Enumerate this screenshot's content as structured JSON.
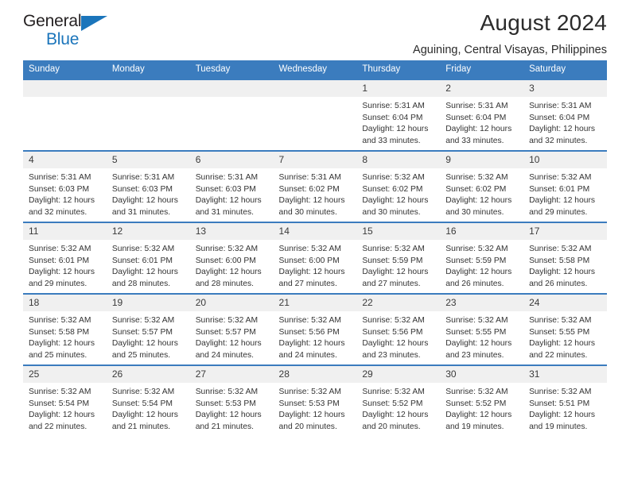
{
  "brand": {
    "name_top": "General",
    "name_bottom": "Blue",
    "accent_color": "#1b75bb"
  },
  "header": {
    "title": "August 2024",
    "subtitle": "Aguining, Central Visayas, Philippines"
  },
  "calendar": {
    "header_color": "#3b7cbe",
    "weekday_headers": [
      "Sunday",
      "Monday",
      "Tuesday",
      "Wednesday",
      "Thursday",
      "Friday",
      "Saturday"
    ],
    "weeks": [
      [
        {
          "day": "",
          "lines": []
        },
        {
          "day": "",
          "lines": []
        },
        {
          "day": "",
          "lines": []
        },
        {
          "day": "",
          "lines": []
        },
        {
          "day": "1",
          "lines": [
            "Sunrise: 5:31 AM",
            "Sunset: 6:04 PM",
            "Daylight: 12 hours",
            "and 33 minutes."
          ]
        },
        {
          "day": "2",
          "lines": [
            "Sunrise: 5:31 AM",
            "Sunset: 6:04 PM",
            "Daylight: 12 hours",
            "and 33 minutes."
          ]
        },
        {
          "day": "3",
          "lines": [
            "Sunrise: 5:31 AM",
            "Sunset: 6:04 PM",
            "Daylight: 12 hours",
            "and 32 minutes."
          ]
        }
      ],
      [
        {
          "day": "4",
          "lines": [
            "Sunrise: 5:31 AM",
            "Sunset: 6:03 PM",
            "Daylight: 12 hours",
            "and 32 minutes."
          ]
        },
        {
          "day": "5",
          "lines": [
            "Sunrise: 5:31 AM",
            "Sunset: 6:03 PM",
            "Daylight: 12 hours",
            "and 31 minutes."
          ]
        },
        {
          "day": "6",
          "lines": [
            "Sunrise: 5:31 AM",
            "Sunset: 6:03 PM",
            "Daylight: 12 hours",
            "and 31 minutes."
          ]
        },
        {
          "day": "7",
          "lines": [
            "Sunrise: 5:31 AM",
            "Sunset: 6:02 PM",
            "Daylight: 12 hours",
            "and 30 minutes."
          ]
        },
        {
          "day": "8",
          "lines": [
            "Sunrise: 5:32 AM",
            "Sunset: 6:02 PM",
            "Daylight: 12 hours",
            "and 30 minutes."
          ]
        },
        {
          "day": "9",
          "lines": [
            "Sunrise: 5:32 AM",
            "Sunset: 6:02 PM",
            "Daylight: 12 hours",
            "and 30 minutes."
          ]
        },
        {
          "day": "10",
          "lines": [
            "Sunrise: 5:32 AM",
            "Sunset: 6:01 PM",
            "Daylight: 12 hours",
            "and 29 minutes."
          ]
        }
      ],
      [
        {
          "day": "11",
          "lines": [
            "Sunrise: 5:32 AM",
            "Sunset: 6:01 PM",
            "Daylight: 12 hours",
            "and 29 minutes."
          ]
        },
        {
          "day": "12",
          "lines": [
            "Sunrise: 5:32 AM",
            "Sunset: 6:01 PM",
            "Daylight: 12 hours",
            "and 28 minutes."
          ]
        },
        {
          "day": "13",
          "lines": [
            "Sunrise: 5:32 AM",
            "Sunset: 6:00 PM",
            "Daylight: 12 hours",
            "and 28 minutes."
          ]
        },
        {
          "day": "14",
          "lines": [
            "Sunrise: 5:32 AM",
            "Sunset: 6:00 PM",
            "Daylight: 12 hours",
            "and 27 minutes."
          ]
        },
        {
          "day": "15",
          "lines": [
            "Sunrise: 5:32 AM",
            "Sunset: 5:59 PM",
            "Daylight: 12 hours",
            "and 27 minutes."
          ]
        },
        {
          "day": "16",
          "lines": [
            "Sunrise: 5:32 AM",
            "Sunset: 5:59 PM",
            "Daylight: 12 hours",
            "and 26 minutes."
          ]
        },
        {
          "day": "17",
          "lines": [
            "Sunrise: 5:32 AM",
            "Sunset: 5:58 PM",
            "Daylight: 12 hours",
            "and 26 minutes."
          ]
        }
      ],
      [
        {
          "day": "18",
          "lines": [
            "Sunrise: 5:32 AM",
            "Sunset: 5:58 PM",
            "Daylight: 12 hours",
            "and 25 minutes."
          ]
        },
        {
          "day": "19",
          "lines": [
            "Sunrise: 5:32 AM",
            "Sunset: 5:57 PM",
            "Daylight: 12 hours",
            "and 25 minutes."
          ]
        },
        {
          "day": "20",
          "lines": [
            "Sunrise: 5:32 AM",
            "Sunset: 5:57 PM",
            "Daylight: 12 hours",
            "and 24 minutes."
          ]
        },
        {
          "day": "21",
          "lines": [
            "Sunrise: 5:32 AM",
            "Sunset: 5:56 PM",
            "Daylight: 12 hours",
            "and 24 minutes."
          ]
        },
        {
          "day": "22",
          "lines": [
            "Sunrise: 5:32 AM",
            "Sunset: 5:56 PM",
            "Daylight: 12 hours",
            "and 23 minutes."
          ]
        },
        {
          "day": "23",
          "lines": [
            "Sunrise: 5:32 AM",
            "Sunset: 5:55 PM",
            "Daylight: 12 hours",
            "and 23 minutes."
          ]
        },
        {
          "day": "24",
          "lines": [
            "Sunrise: 5:32 AM",
            "Sunset: 5:55 PM",
            "Daylight: 12 hours",
            "and 22 minutes."
          ]
        }
      ],
      [
        {
          "day": "25",
          "lines": [
            "Sunrise: 5:32 AM",
            "Sunset: 5:54 PM",
            "Daylight: 12 hours",
            "and 22 minutes."
          ]
        },
        {
          "day": "26",
          "lines": [
            "Sunrise: 5:32 AM",
            "Sunset: 5:54 PM",
            "Daylight: 12 hours",
            "and 21 minutes."
          ]
        },
        {
          "day": "27",
          "lines": [
            "Sunrise: 5:32 AM",
            "Sunset: 5:53 PM",
            "Daylight: 12 hours",
            "and 21 minutes."
          ]
        },
        {
          "day": "28",
          "lines": [
            "Sunrise: 5:32 AM",
            "Sunset: 5:53 PM",
            "Daylight: 12 hours",
            "and 20 minutes."
          ]
        },
        {
          "day": "29",
          "lines": [
            "Sunrise: 5:32 AM",
            "Sunset: 5:52 PM",
            "Daylight: 12 hours",
            "and 20 minutes."
          ]
        },
        {
          "day": "30",
          "lines": [
            "Sunrise: 5:32 AM",
            "Sunset: 5:52 PM",
            "Daylight: 12 hours",
            "and 19 minutes."
          ]
        },
        {
          "day": "31",
          "lines": [
            "Sunrise: 5:32 AM",
            "Sunset: 5:51 PM",
            "Daylight: 12 hours",
            "and 19 minutes."
          ]
        }
      ]
    ]
  }
}
